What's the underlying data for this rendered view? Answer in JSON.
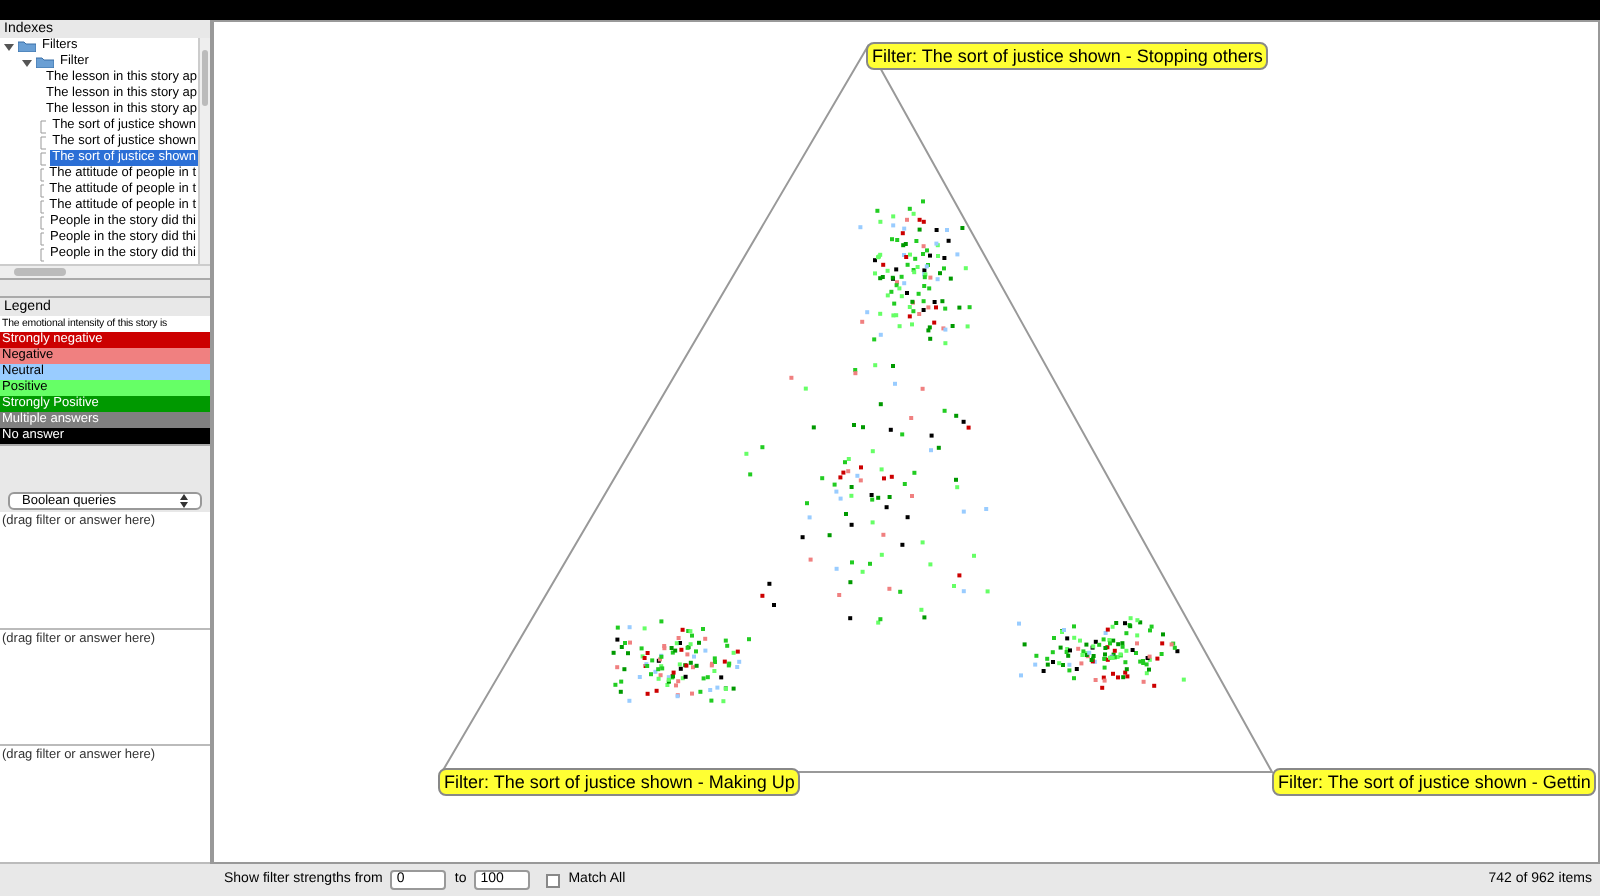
{
  "indexes": {
    "title": "Indexes",
    "tree": [
      {
        "label": "Filters",
        "expanded": true,
        "selected": false,
        "children": [
          {
            "label": "Filter",
            "expanded": true,
            "selected": false,
            "children": [
              {
                "label": "The lesson in this story ap",
                "selected": false
              },
              {
                "label": "The lesson in this story ap",
                "selected": false
              },
              {
                "label": "The lesson in this story ap",
                "selected": false
              },
              {
                "label": "The sort of justice shown",
                "selected": false
              },
              {
                "label": "The sort of justice shown",
                "selected": false
              },
              {
                "label": "The sort of justice shown",
                "selected": true
              },
              {
                "label": "The attitude of people in t",
                "selected": false
              },
              {
                "label": "The attitude of people in t",
                "selected": false
              },
              {
                "label": "The attitude of people in t",
                "selected": false
              },
              {
                "label": "People in the story did thi",
                "selected": false
              },
              {
                "label": "People in the story did thi",
                "selected": false
              },
              {
                "label": "People in the story did thi",
                "selected": false
              }
            ]
          }
        ]
      }
    ]
  },
  "legend": {
    "title": "Legend",
    "question": "The emotional intensity of this story is",
    "items": [
      {
        "label": "Strongly negative",
        "color": "#cc0000"
      },
      {
        "label": "Negative",
        "color": "#f08080"
      },
      {
        "label": "Neutral",
        "color": "#99ccff"
      },
      {
        "label": "Positive",
        "color": "#66ff66"
      },
      {
        "label": "Strongly Positive",
        "color": "#009900"
      },
      {
        "label": "Multiple answers",
        "color": "#808080"
      },
      {
        "label": "No answer",
        "color": "#000000"
      }
    ]
  },
  "queries": {
    "mode": "Boolean queries",
    "zones": [
      {
        "placeholder": "(drag filter or answer here)"
      },
      {
        "placeholder": "(drag filter or answer here)"
      },
      {
        "placeholder": "(drag filter or answer here)"
      }
    ]
  },
  "plot": {
    "labels": [
      "Filter: The sort of justice shown - Stopping others",
      "Filter: The sort of justice shown - Making Up",
      "Filter: The sort of justice shown - Gettin"
    ]
  },
  "status_bar": {
    "from_label": "Show filter strengths from",
    "from_value": "0",
    "to_label": "to",
    "to_value": "100",
    "match_all": {
      "label": "Match All",
      "checked": false
    },
    "count": "742 of 962 items"
  }
}
